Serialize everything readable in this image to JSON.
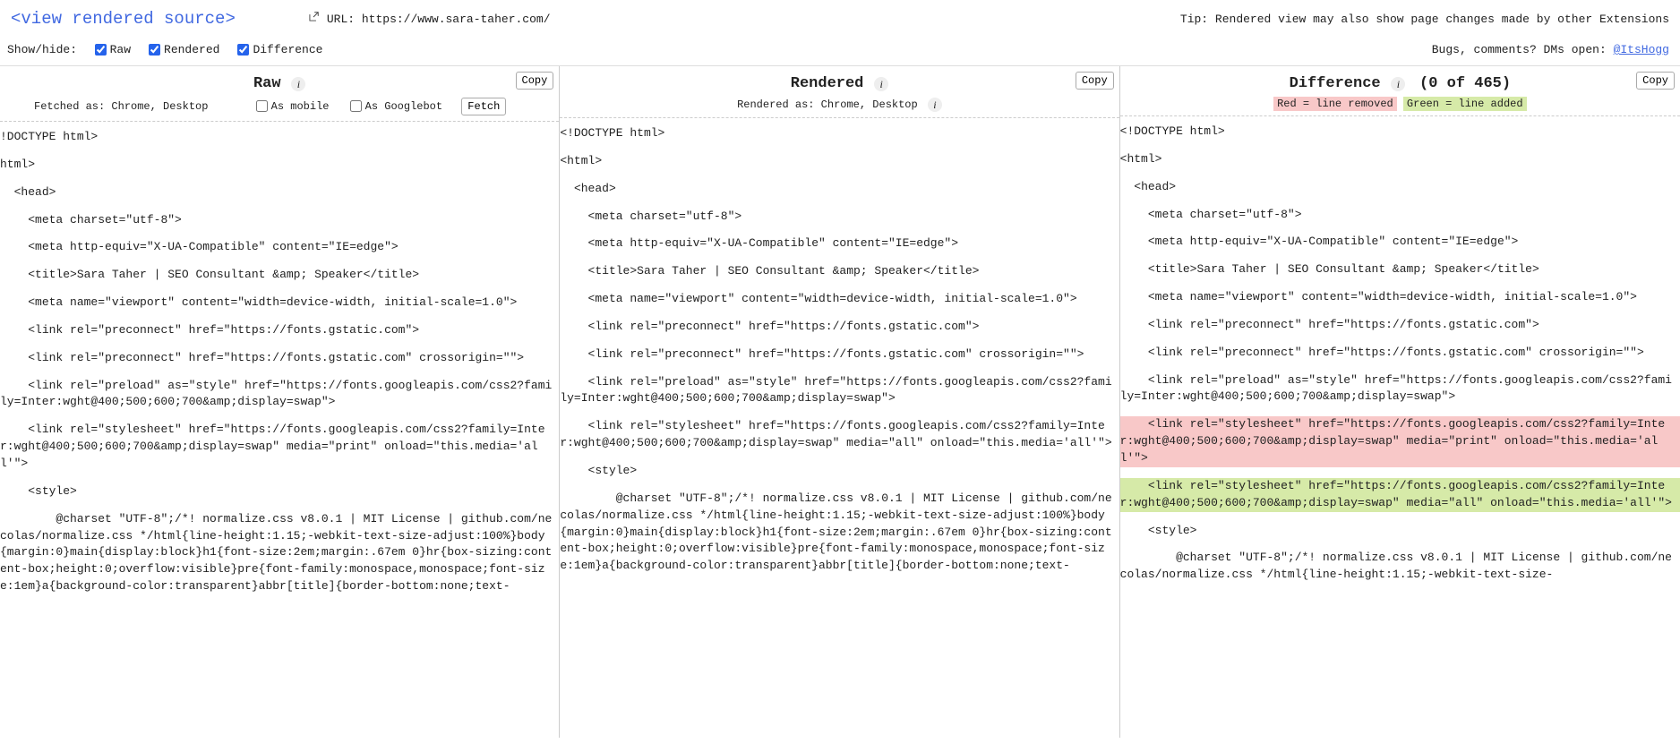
{
  "header": {
    "logo": "<view rendered source>",
    "url_label": "URL:",
    "url_value": "https://www.sara-taher.com/",
    "tip": "Tip: Rendered view may also show page changes made by other Extensions"
  },
  "toolbar": {
    "showhide_label": "Show/hide:",
    "raw_label": "Raw",
    "rendered_label": "Rendered",
    "difference_label": "Difference",
    "raw_checked": true,
    "rendered_checked": true,
    "difference_checked": true,
    "bugs_text": "Bugs, comments? DMs open: ",
    "bugs_link": "@ItsHogg"
  },
  "panels": {
    "raw": {
      "title": "Raw",
      "copy": "Copy",
      "fetched_as": "Fetched as: Chrome, Desktop",
      "as_mobile": "As mobile",
      "as_googlebot": "As Googlebot",
      "fetch": "Fetch",
      "lines": [
        "!DOCTYPE html>",
        "html>",
        "  <head>",
        "    <meta charset=\"utf-8\">",
        "    <meta http-equiv=\"X-UA-Compatible\" content=\"IE=edge\">",
        "    <title>Sara Taher | SEO Consultant &amp; Speaker</title>",
        "    <meta name=\"viewport\" content=\"width=device-width, initial-scale=1.0\">",
        "    <link rel=\"preconnect\" href=\"https://fonts.gstatic.com\">",
        "    <link rel=\"preconnect\" href=\"https://fonts.gstatic.com\" crossorigin=\"\">",
        "    <link rel=\"preload\" as=\"style\" href=\"https://fonts.googleapis.com/css2?family=Inter:wght@400;500;600;700&amp;display=swap\">",
        "    <link rel=\"stylesheet\" href=\"https://fonts.googleapis.com/css2?family=Inter:wght@400;500;600;700&amp;display=swap\" media=\"print\" onload=\"this.media='all'\">",
        "    <style>",
        "        @charset \"UTF-8\";/*! normalize.css v8.0.1 | MIT License | github.com/necolas/normalize.css */html{line-height:1.15;-webkit-text-size-adjust:100%}body{margin:0}main{display:block}h1{font-size:2em;margin:.67em 0}hr{box-sizing:content-box;height:0;overflow:visible}pre{font-family:monospace,monospace;font-size:1em}a{background-color:transparent}abbr[title]{border-bottom:none;text-"
      ]
    },
    "rendered": {
      "title": "Rendered",
      "copy": "Copy",
      "rendered_as": "Rendered as: Chrome, Desktop",
      "lines": [
        "<!DOCTYPE html>",
        "<html>",
        "  <head>",
        "    <meta charset=\"utf-8\">",
        "    <meta http-equiv=\"X-UA-Compatible\" content=\"IE=edge\">",
        "    <title>Sara Taher | SEO Consultant &amp; Speaker</title>",
        "    <meta name=\"viewport\" content=\"width=device-width, initial-scale=1.0\">",
        "    <link rel=\"preconnect\" href=\"https://fonts.gstatic.com\">",
        "    <link rel=\"preconnect\" href=\"https://fonts.gstatic.com\" crossorigin=\"\">",
        "    <link rel=\"preload\" as=\"style\" href=\"https://fonts.googleapis.com/css2?family=Inter:wght@400;500;600;700&amp;display=swap\">",
        "    <link rel=\"stylesheet\" href=\"https://fonts.googleapis.com/css2?family=Inter:wght@400;500;600;700&amp;display=swap\" media=\"all\" onload=\"this.media='all'\">",
        "    <style>",
        "        @charset \"UTF-8\";/*! normalize.css v8.0.1 | MIT License | github.com/necolas/normalize.css */html{line-height:1.15;-webkit-text-size-adjust:100%}body{margin:0}main{display:block}h1{font-size:2em;margin:.67em 0}hr{box-sizing:content-box;height:0;overflow:visible}pre{font-family:monospace,monospace;font-size:1em}a{background-color:transparent}abbr[title]{border-bottom:none;text-"
      ]
    },
    "difference": {
      "title": "Difference",
      "counter": "(0 of 465)",
      "copy": "Copy",
      "legend_removed": "Red = line removed",
      "legend_added": "Green = line added",
      "lines": [
        {
          "t": "<!DOCTYPE html>",
          "k": "n"
        },
        {
          "t": "<html>",
          "k": "n"
        },
        {
          "t": "  <head>",
          "k": "n"
        },
        {
          "t": "    <meta charset=\"utf-8\">",
          "k": "n"
        },
        {
          "t": "    <meta http-equiv=\"X-UA-Compatible\" content=\"IE=edge\">",
          "k": "n"
        },
        {
          "t": "    <title>Sara Taher | SEO Consultant &amp; Speaker</title>",
          "k": "n"
        },
        {
          "t": "    <meta name=\"viewport\" content=\"width=device-width, initial-scale=1.0\">",
          "k": "n"
        },
        {
          "t": "    <link rel=\"preconnect\" href=\"https://fonts.gstatic.com\">",
          "k": "n"
        },
        {
          "t": "    <link rel=\"preconnect\" href=\"https://fonts.gstatic.com\" crossorigin=\"\">",
          "k": "n"
        },
        {
          "t": "    <link rel=\"preload\" as=\"style\" href=\"https://fonts.googleapis.com/css2?family=Inter:wght@400;500;600;700&amp;display=swap\">",
          "k": "n"
        },
        {
          "t": "    <link rel=\"stylesheet\" href=\"https://fonts.googleapis.com/css2?family=Inter:wght@400;500;600;700&amp;display=swap\" media=\"print\" onload=\"this.media='all'\">",
          "k": "r"
        },
        {
          "t": "    <link rel=\"stylesheet\" href=\"https://fonts.googleapis.com/css2?family=Inter:wght@400;500;600;700&amp;display=swap\" media=\"all\" onload=\"this.media='all'\">",
          "k": "a"
        },
        {
          "t": "    <style>",
          "k": "n"
        },
        {
          "t": "        @charset \"UTF-8\";/*! normalize.css v8.0.1 | MIT License | github.com/necolas/normalize.css */html{line-height:1.15;-webkit-text-size-",
          "k": "n"
        }
      ]
    }
  }
}
